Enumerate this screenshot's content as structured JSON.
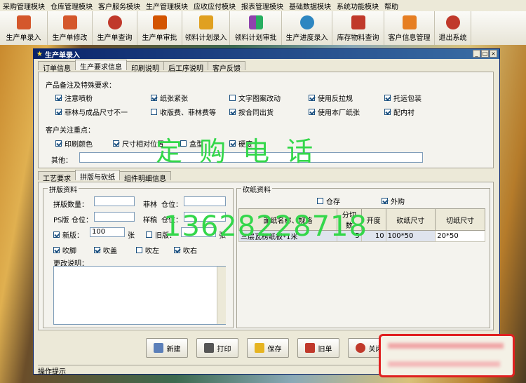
{
  "menu": [
    "采购管理模块",
    "仓库管理模块",
    "客户服务模块",
    "生产管理模块",
    "应收应付模块",
    "报表管理模块",
    "基础数据模块",
    "系统功能模块",
    "帮助"
  ],
  "toolbar": [
    {
      "label": "生产单录入",
      "icon": "edit-icon",
      "color": "#d4572b"
    },
    {
      "label": "生产单修改",
      "icon": "modify-icon",
      "color": "#d4572b"
    },
    {
      "label": "生产单查询",
      "icon": "people-icon",
      "color": "#c0392b"
    },
    {
      "label": "生产单审批",
      "icon": "gift-icon",
      "color": "#d35400"
    },
    {
      "label": "领料计划录入",
      "icon": "hand-icon",
      "color": "#e0a020"
    },
    {
      "label": "领料计划审批",
      "icon": "blocks-icon",
      "color": "#8e44ad"
    },
    {
      "label": "生产进度录入",
      "icon": "person-icon",
      "color": "#2e86c1"
    },
    {
      "label": "库存物料查询",
      "icon": "chart-icon",
      "color": "#c0392b"
    },
    {
      "label": "客户信息管理",
      "icon": "box-icon",
      "color": "#e67e22"
    },
    {
      "label": "退出系统",
      "icon": "exit-icon",
      "color": "#c0392b"
    }
  ],
  "window": {
    "title": "生产单录入"
  },
  "tabs": [
    "订单信息",
    "生产要求信息",
    "印刷说明",
    "后工序说明",
    "客户反馈"
  ],
  "remarks": {
    "title": "产品备注及特殊要求：",
    "items": [
      {
        "label": "注意喷粉",
        "checked": true
      },
      {
        "label": "纸张紧张",
        "checked": true
      },
      {
        "label": "文字图案改动",
        "checked": false
      },
      {
        "label": "使用反拉规",
        "checked": true
      },
      {
        "label": "托运包装",
        "checked": true
      },
      {
        "label": "菲林与成品尺寸不一",
        "checked": true
      },
      {
        "label": "收版费、菲林费等",
        "checked": false
      },
      {
        "label": "按合同出货",
        "checked": true
      },
      {
        "label": "使用本厂纸张",
        "checked": true
      },
      {
        "label": "配内衬",
        "checked": true
      }
    ]
  },
  "focus": {
    "title": "客户关注重点：",
    "items": [
      {
        "label": "印刷颜色",
        "checked": true
      },
      {
        "label": "尺寸相对位置",
        "checked": true
      },
      {
        "label": "盒型",
        "checked": false
      },
      {
        "label": "硬度",
        "checked": true
      }
    ],
    "other_label": "其他："
  },
  "overlay": {
    "line1": "定 购 电 话",
    "line2": "13628228718"
  },
  "subtabs": [
    "工艺要求",
    "拼版与砍纸",
    "组件明细信息"
  ],
  "pinban": {
    "group_title": "拼版资料",
    "qty_label": "拼版数量：",
    "film_label": "菲林",
    "warehouse_label": "仓位：",
    "ps_label": "PS版",
    "sample_label": "样稿",
    "new_label": "新版：",
    "new_value": "100",
    "unit": "张",
    "old_label": "旧版：",
    "unit2": "张",
    "chk_items": [
      {
        "label": "吹脚",
        "checked": true
      },
      {
        "label": "吹盖",
        "checked": true
      },
      {
        "label": "吹左",
        "checked": false
      },
      {
        "label": "吹右",
        "checked": true
      }
    ],
    "change_label": "更改说明："
  },
  "kanzhi": {
    "group_title": "砍纸资料",
    "stock_label": "仓存",
    "stock_checked": false,
    "buy_label": "外购",
    "buy_checked": true,
    "headers": [
      "面纸名称、规格",
      "分切数",
      "开度",
      "砍纸尺寸",
      "切纸尺寸"
    ],
    "rows": [
      [
        "三层瓦楞纸板*1米",
        "5",
        "10",
        "100*50",
        "20*50"
      ]
    ]
  },
  "buttons": [
    {
      "label": "新建",
      "icon": "new-icon",
      "color": "#5b7fb9"
    },
    {
      "label": "打印",
      "icon": "print-icon",
      "color": "#555555"
    },
    {
      "label": "保存",
      "icon": "save-icon",
      "color": "#e6b422"
    },
    {
      "label": "旧单",
      "icon": "old-icon",
      "color": "#c0392b"
    },
    {
      "label": "关闭",
      "icon": "close-icon",
      "color": "#c0392b"
    }
  ],
  "status": {
    "label": "操作提示"
  }
}
